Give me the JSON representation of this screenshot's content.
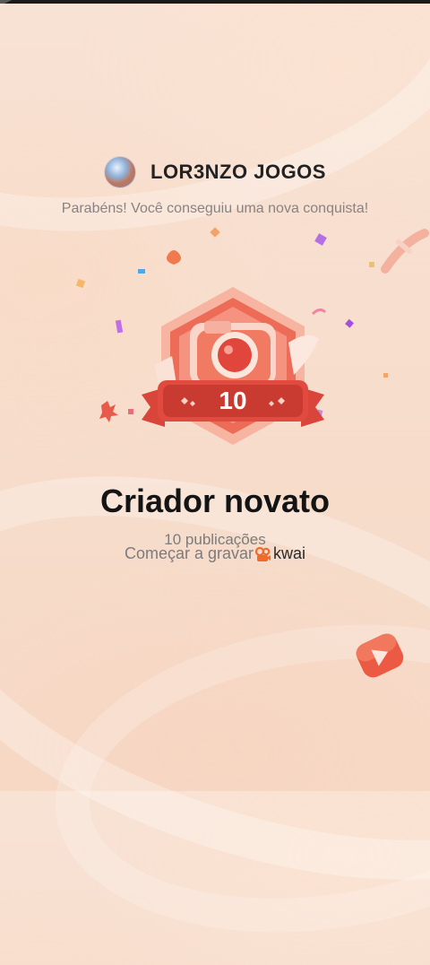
{
  "profile": {
    "name": "LOR3NZO JOGOS"
  },
  "message": "Parabéns! Você conseguiu uma nova conquista!",
  "badge": {
    "number": "10",
    "accent": "#e5544a"
  },
  "achievement": {
    "title": "Criador novato",
    "subtitle": "10 publicações",
    "cta_label": "Começar a gravar",
    "brand": "kwai"
  },
  "icons": [
    "avatar",
    "camera-icon",
    "kwai-logo-icon",
    "play-icon",
    "confetti"
  ]
}
